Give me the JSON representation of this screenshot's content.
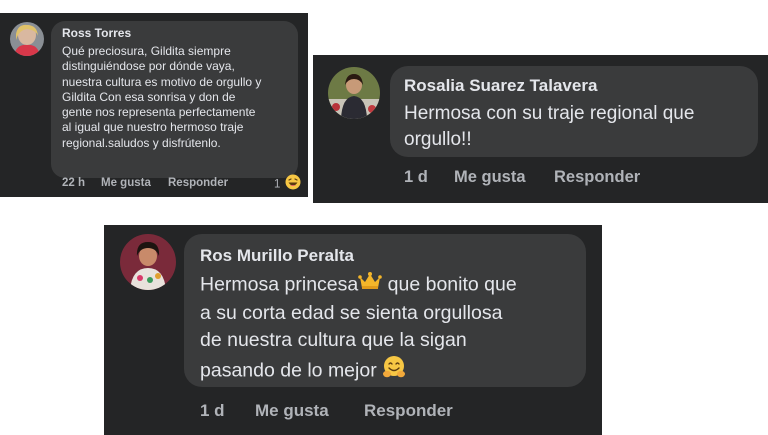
{
  "comments": [
    {
      "author": "Ross Torres",
      "lines": [
        "Qué preciosura, Gildita siempre",
        "distinguiéndose por dónde vaya,",
        "nuestra cultura es motivo de orgullo y",
        "Gildita Con esa sonrisa y don de",
        "gente  nos representa perfectamente",
        "al igual que nuestro hermoso traje",
        "regional.saludos y disfrútenlo."
      ],
      "time": "22 h",
      "like_label": "Me gusta",
      "reply_label": "Responder",
      "reaction_count": "1",
      "reaction_icon": "haha-reaction-icon"
    },
    {
      "author": "Rosalia Suarez Talavera",
      "lines": [
        "Hermosa con su traje regional que",
        "orgullo!!"
      ],
      "time": "1 d",
      "like_label": "Me gusta",
      "reply_label": "Responder"
    },
    {
      "author": "Ros Murillo Peralta",
      "lines": [
        "Hermosa princesa",
        "a su corta edad se sienta orgullosa",
        "de nuestra cultura que la sigan",
        "pasando de lo mejor"
      ],
      "line1_rest": " que bonito que",
      "inline_emojis": [
        "crown-emoji",
        "hugging-face-emoji"
      ],
      "time": "1 d",
      "like_label": "Me gusta",
      "reply_label": "Responder"
    }
  ],
  "colors": {
    "panel_bg": "#242526",
    "bubble_bg": "#3a3b3c",
    "text": "#e4e6eb",
    "secondary_text": "#b0b3b8"
  }
}
